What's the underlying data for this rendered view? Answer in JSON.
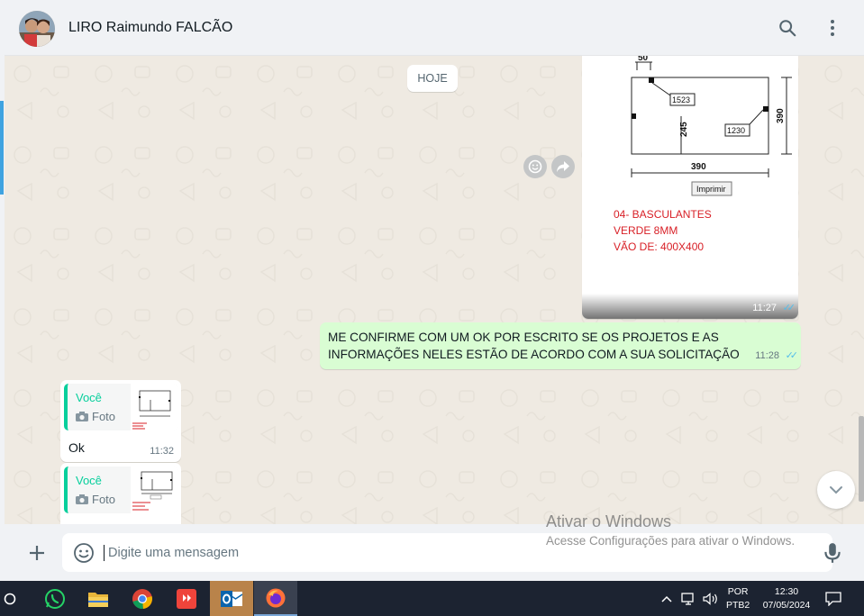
{
  "header": {
    "contact_name": "LIRO Raimundo FALCÃO",
    "search_icon": "search-icon",
    "menu_icon": "kebab-menu-icon"
  },
  "chat": {
    "date_chip": "HOJE",
    "image_message": {
      "drawing": {
        "dim_top": "50",
        "label_a": "1523",
        "label_b": "1230",
        "dim_vertical_inner": "245",
        "dim_right": "390",
        "dim_bottom": "390",
        "print_button": "Imprimir",
        "note_line1": "04- BASCULANTES",
        "note_line2": "VERDE 8MM",
        "note_line3": "VÃO DE: 400X400"
      },
      "time": "11:27",
      "status": "read"
    },
    "text_message": {
      "text": "ME CONFIRME COM UM OK POR ESCRITO SE OS PROJETOS E AS INFORMAÇÕES NELES ESTÃO DE ACORDO COM A SUA SOLICITAÇÃO",
      "time": "11:28",
      "status": "read"
    },
    "incoming": [
      {
        "quote_author": "Você",
        "quote_type": "Foto",
        "text": "Ok",
        "time": "11:32"
      },
      {
        "quote_author": "Você",
        "quote_type": "Foto",
        "text": "",
        "time": ""
      }
    ]
  },
  "footer": {
    "placeholder": "Digite uma mensagem"
  },
  "watermark": {
    "title": "Ativar o Windows",
    "subtitle": "Acesse Configurações para ativar o Windows."
  },
  "taskbar": {
    "language": "POR",
    "layout": "PTB2",
    "time": "12:30",
    "date": "07/05/2024"
  },
  "colors": {
    "accent_green": "#06cf9c",
    "outgoing_bubble": "#d9fdd3",
    "chat_bg": "#efeae2",
    "read_ticks": "#53bdeb",
    "drawing_red": "#d81f26"
  }
}
